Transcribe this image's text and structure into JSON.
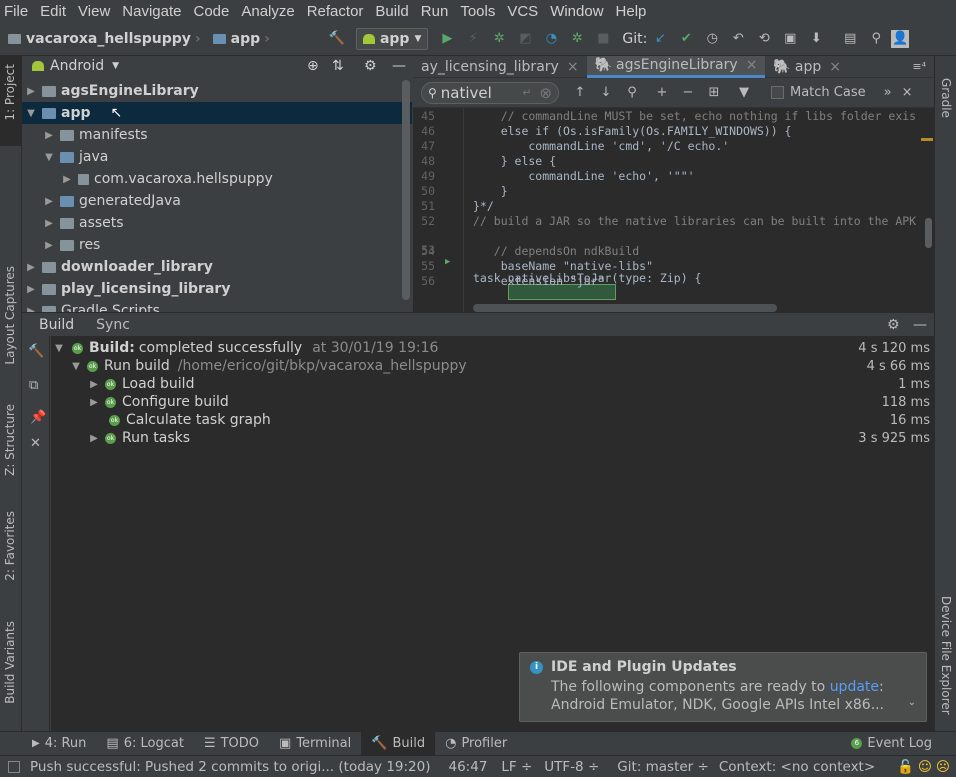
{
  "menu": [
    "File",
    "Edit",
    "View",
    "Navigate",
    "Code",
    "Analyze",
    "Refactor",
    "Build",
    "Run",
    "Tools",
    "VCS",
    "Window",
    "Help"
  ],
  "nav": {
    "project": "vacaroxa_hellspuppy",
    "module": "app",
    "run_config": "app",
    "git_label": "Git:"
  },
  "left_strip": {
    "project_tab": "1: Project",
    "layout_captures": "Layout Captures",
    "structure": "Z: Structure",
    "favorites": "2: Favorites",
    "build_variants": "Build Variants"
  },
  "right_strip": {
    "gradle": "Gradle",
    "device_explorer": "Device File Explorer"
  },
  "project": {
    "view_mode": "Android",
    "tree": [
      {
        "label": "agsEngineLibrary",
        "bold": true
      },
      {
        "label": "app",
        "bold": true
      },
      {
        "label": "manifests"
      },
      {
        "label": "java"
      },
      {
        "label": "com.vacaroxa.hellspuppy"
      },
      {
        "label": "generatedJava"
      },
      {
        "label": "assets"
      },
      {
        "label": "res"
      },
      {
        "label": "downloader_library",
        "bold": true
      },
      {
        "label": "play_licensing_library",
        "bold": true
      },
      {
        "label": "Gradle Scripts"
      }
    ]
  },
  "editor": {
    "tabs": [
      "ay_licensing_library",
      "agsEngineLibrary",
      "app"
    ],
    "search_text": "nativel",
    "match_case_label": "Match Case",
    "lines": [
      {
        "n": "45",
        "text": "    // commandLine MUST be set, echo nothing if libs folder exis"
      },
      {
        "n": "46",
        "text": "    else if (Os.isFamily(Os.FAMILY_WINDOWS)) {"
      },
      {
        "n": "47",
        "text": "        commandLine 'cmd', '/C echo.'"
      },
      {
        "n": "48",
        "text": "    } else {"
      },
      {
        "n": "49",
        "text": "        commandLine 'echo', '\"\"'"
      },
      {
        "n": "50",
        "text": "    }"
      },
      {
        "n": "51",
        "text": "}*/"
      },
      {
        "n": "52",
        "text": "// build a JAR so the native libraries can be built into the APK"
      },
      {
        "n": "53",
        "text": "task nativeLibsToJar(type: Zip) {"
      },
      {
        "n": "54",
        "text": "   // dependsOn ndkBuild"
      },
      {
        "n": "55",
        "text": "    baseName \"native-libs\""
      },
      {
        "n": "56",
        "text": "    extension \"jar\""
      }
    ]
  },
  "build": {
    "tabs": [
      "Build",
      "Sync"
    ],
    "rows": [
      {
        "label": "Build:",
        "detail": "completed successfully",
        "meta": "at 30/01/19 19:16",
        "time": "4 s 120 ms"
      },
      {
        "label": "Run build",
        "meta": "/home/erico/git/bkp/vacaroxa_hellspuppy",
        "time": "4 s 66 ms"
      },
      {
        "label": "Load build",
        "time": "1 ms"
      },
      {
        "label": "Configure build",
        "time": "118 ms"
      },
      {
        "label": "Calculate task graph",
        "time": "16 ms"
      },
      {
        "label": "Run tasks",
        "time": "3 s 925 ms"
      }
    ]
  },
  "notification": {
    "title": "IDE and Plugin Updates",
    "line1_prefix": "The following components are ready to ",
    "line1_link": "update",
    "line1_suffix": ":",
    "line2": "Android Emulator, NDK, Google APIs Intel x86..."
  },
  "bottom_tabs": {
    "run": "4: Run",
    "logcat": "6: Logcat",
    "todo": "TODO",
    "terminal": "Terminal",
    "build": "Build",
    "profiler": "Profiler",
    "event_log": "Event Log"
  },
  "status": {
    "message": "Push successful: Pushed 2 commits to origi... (today 19:20)",
    "position": "46:47",
    "line_sep": "LF ÷",
    "encoding": "UTF-8 ÷",
    "git": "Git: master ÷",
    "context": "Context: <no context>"
  },
  "colors": {
    "accent": "#4a88c7",
    "success": "#5a9e4b",
    "background": "#3c3f41",
    "editor_bg": "#2b2b2b"
  }
}
